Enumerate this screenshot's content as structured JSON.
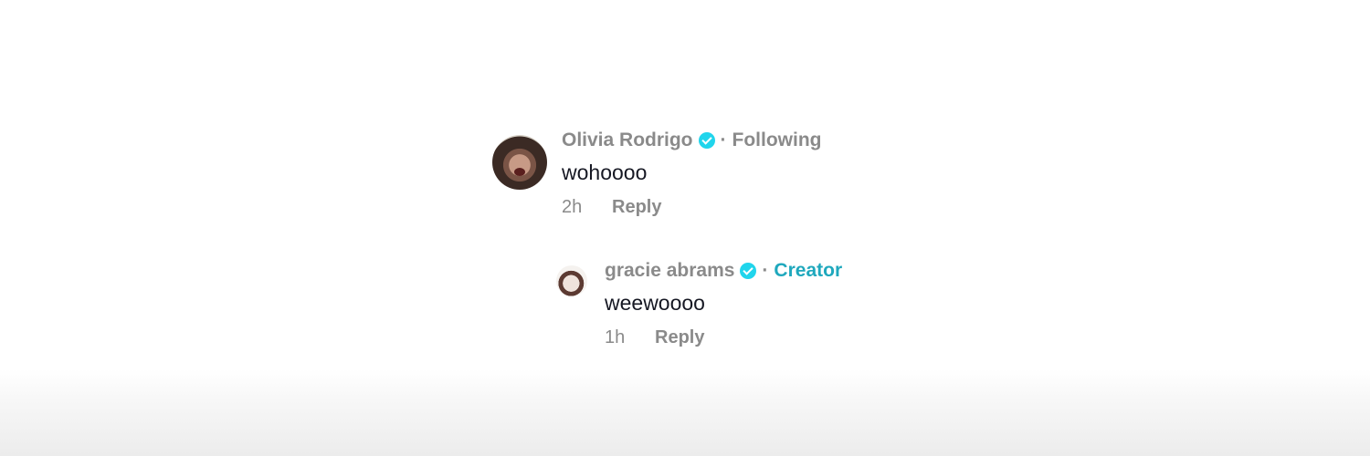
{
  "comments": [
    {
      "username": "Olivia Rodrigo",
      "relation": "Following",
      "text": "wohoooo",
      "time": "2h",
      "reply_label": "Reply",
      "icons": {
        "verified": "verified-badge-icon",
        "avatar": "avatar-image"
      }
    },
    {
      "username": "gracie abrams",
      "relation": "Creator",
      "text": "weewoooo",
      "time": "1h",
      "reply_label": "Reply",
      "icons": {
        "verified": "verified-badge-icon",
        "avatar": "avatar-image"
      }
    }
  ],
  "separator": "·",
  "colors": {
    "verified": "#20d5ec",
    "creator": "#1fa8bd",
    "muted": "#8a8a8a",
    "text": "#161823"
  }
}
